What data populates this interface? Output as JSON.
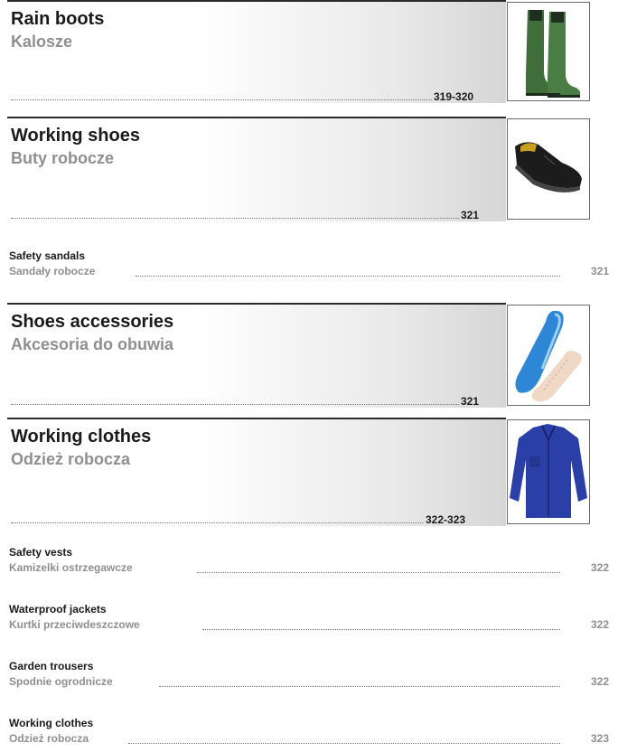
{
  "sections": [
    {
      "title": "Rain boots",
      "subtitle": "Kalosze",
      "pages": "319-320",
      "image": "rain-boots"
    },
    {
      "title": "Working shoes",
      "subtitle": "Buty robocze",
      "pages": "321",
      "image": "working-shoe"
    },
    {
      "title": "Shoes accessories",
      "subtitle": "Akcesoria do obuwia",
      "pages": "321",
      "image": "shoe-insoles"
    },
    {
      "title": "Working clothes",
      "subtitle": "Odzież robocza",
      "pages": "322-323",
      "image": "work-jacket"
    }
  ],
  "entries": [
    {
      "title": "Safety sandals",
      "subtitle": "Sandały robocze",
      "page": "321"
    },
    {
      "title": "Safety vests",
      "subtitle": "Kamizelki ostrzegawcze",
      "page": "322"
    },
    {
      "title": "Waterproof jackets",
      "subtitle": "Kurtki przeciwdeszczowe",
      "page": "322"
    },
    {
      "title": "Garden trousers",
      "subtitle": "Spodnie ogrodnicze",
      "page": "322"
    },
    {
      "title": "Working clothes",
      "subtitle": "Odzież robocza",
      "page": "323"
    }
  ]
}
